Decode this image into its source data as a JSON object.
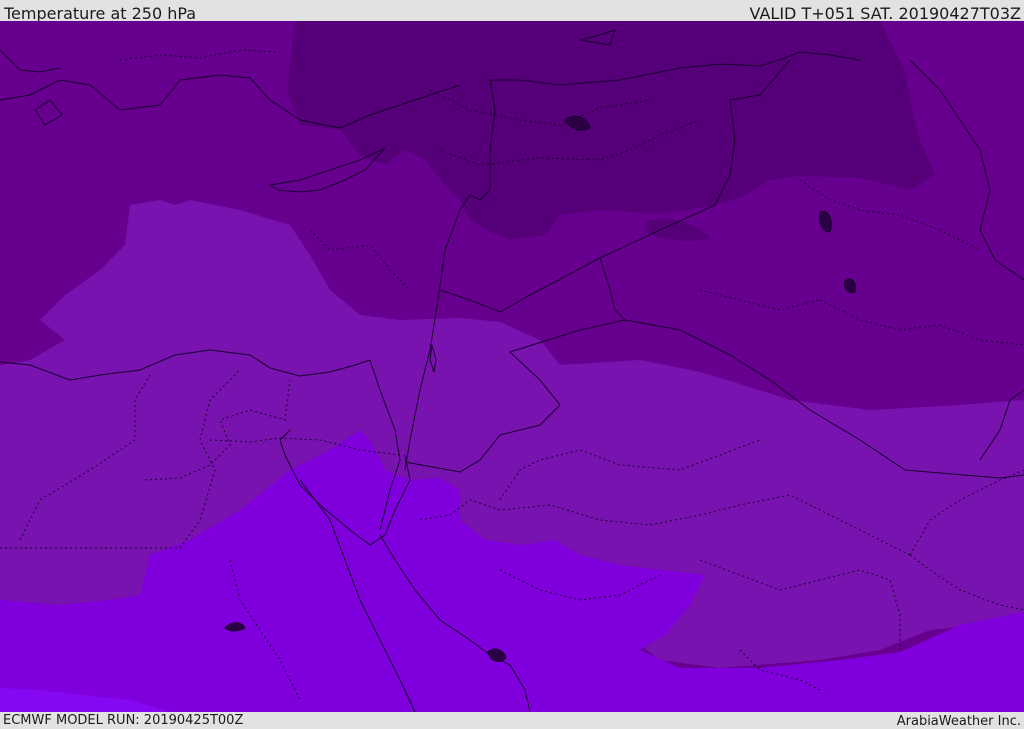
{
  "header": {
    "title": "Temperature at 250 hPa",
    "valid": "VALID T+051 SAT. 20190427T03Z"
  },
  "footer": {
    "model_run": "ECMWF MODEL RUN: 20190425T00Z",
    "credit": "ArabiaWeather Inc."
  },
  "map": {
    "field": "temperature",
    "level": "250 hPa",
    "colors": {
      "darkest": "#550079",
      "dark": "#68008f",
      "mid": "#7813b0",
      "light": "#7f00dc",
      "lightest": "#8409f2"
    }
  }
}
